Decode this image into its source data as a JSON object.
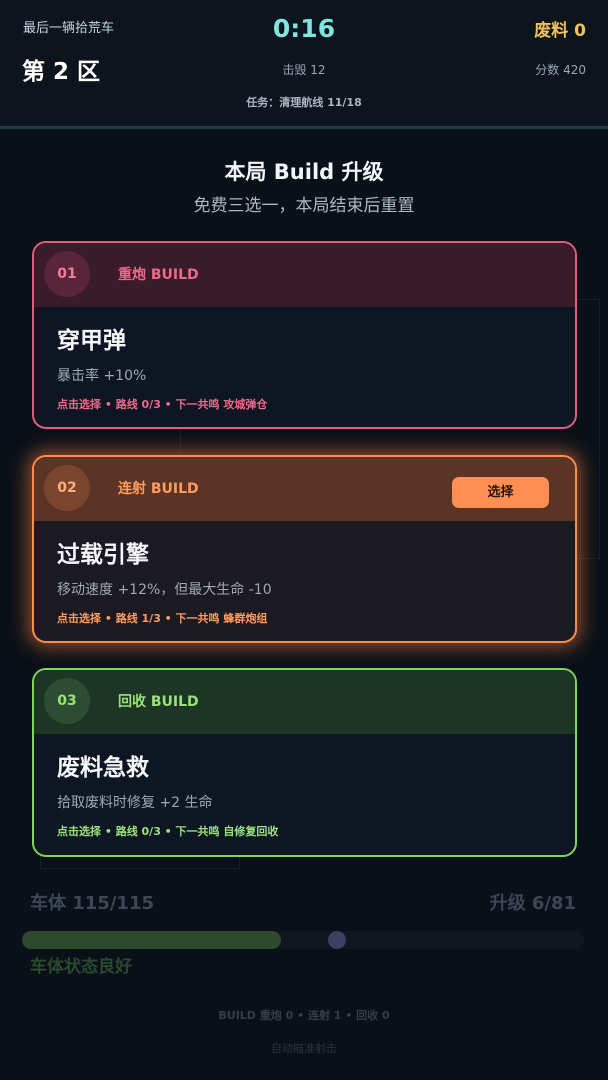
{
  "hud": {
    "game_title": "最后一辆拾荒车",
    "zone": "第 2 区",
    "timer": "0:16",
    "kills": "击毁 12",
    "mission": "任务：清理航线 11/18",
    "scrap": "废料 0",
    "score": "分数 420"
  },
  "panel": {
    "title": "本局 Build 升级",
    "subtitle": "免费三选一，本局结束后重置"
  },
  "cards": [
    {
      "index": "01",
      "build": "重炮 BUILD",
      "name": "穿甲弹",
      "desc": "暴击率 +10%",
      "route": "点击选择 • 路线 0/3 • 下一共鸣 攻城弹仓",
      "color": "#e35b7b"
    },
    {
      "index": "02",
      "build": "连射 BUILD",
      "name": "过载引擎",
      "desc": "移动速度 +12%，但最大生命 -10",
      "route": "点击选择 • 路线 1/3 • 下一共鸣 蜂群炮组",
      "select_label": "选择",
      "color": "#ff8a4c"
    },
    {
      "index": "03",
      "build": "回收 BUILD",
      "name": "废料急救",
      "desc": "拾取废料时修复 +2 生命",
      "route": "点击选择 • 路线 0/3 • 下一共鸣 自修复回收",
      "color": "#7fd45a"
    }
  ],
  "status": {
    "hull": "车体 115/115",
    "upgrade": "升级 6/81",
    "hull_fraction": 0.46,
    "hull_status": "车体状态良好",
    "build_summary": "BUILD  重炮 0 • 连射 1 • 回收 0",
    "auto_fire": "自动瞄准射击"
  }
}
